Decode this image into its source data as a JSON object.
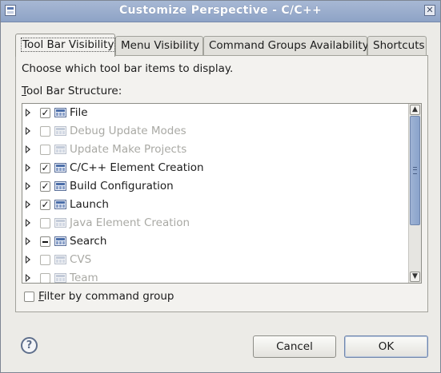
{
  "window": {
    "title": "Customize Perspective - C/C++",
    "close_glyph": "✕"
  },
  "tabs": [
    {
      "label": "Tool Bar Visibility",
      "active": true
    },
    {
      "label": "Menu Visibility",
      "active": false
    },
    {
      "label": "Command Groups Availability",
      "active": false
    },
    {
      "label": "Shortcuts",
      "active": false
    }
  ],
  "panel": {
    "description": "Choose which tool bar items to display.",
    "structure_label_mnemonic": "T",
    "structure_label_rest": "ool Bar Structure:"
  },
  "tree": {
    "items": [
      {
        "label": "File",
        "state": "checked",
        "enabled": true
      },
      {
        "label": "Debug Update Modes",
        "state": "unchecked",
        "enabled": false
      },
      {
        "label": "Update Make Projects",
        "state": "unchecked",
        "enabled": false
      },
      {
        "label": "C/C++ Element Creation",
        "state": "checked",
        "enabled": true
      },
      {
        "label": "Build Configuration",
        "state": "checked",
        "enabled": true
      },
      {
        "label": "Launch",
        "state": "checked",
        "enabled": true
      },
      {
        "label": "Java Element Creation",
        "state": "unchecked",
        "enabled": false
      },
      {
        "label": "Search",
        "state": "mixed",
        "enabled": true
      },
      {
        "label": "CVS",
        "state": "unchecked",
        "enabled": false
      },
      {
        "label": "Team",
        "state": "unchecked",
        "enabled": false
      }
    ],
    "scroll_up_glyph": "▲",
    "scroll_down_glyph": "▼"
  },
  "filter": {
    "mnemonic": "F",
    "label_rest": "ilter by command group",
    "checked": false
  },
  "footer": {
    "help_glyph": "?",
    "cancel_label": "Cancel",
    "ok_label": "OK"
  },
  "colors": {
    "titlebar": "#8ea3c6",
    "disabled_text": "#a9a9a4",
    "scroll_thumb": "#8aa3cb"
  }
}
